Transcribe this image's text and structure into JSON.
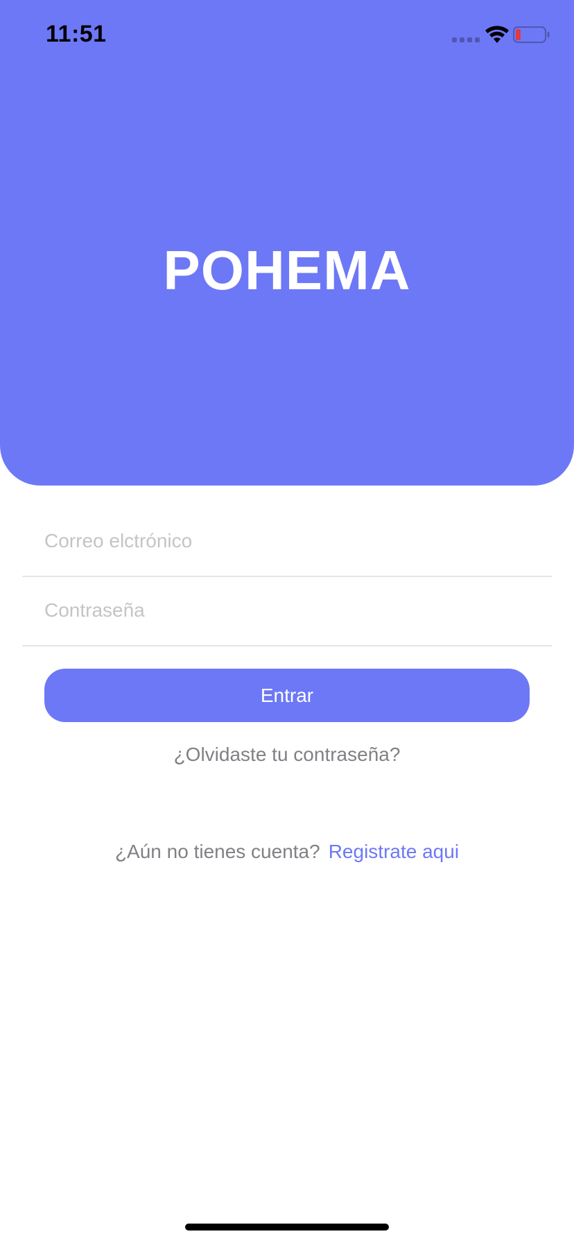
{
  "status_bar": {
    "time": "11:51"
  },
  "hero": {
    "title": "POHEMA",
    "background_color": "#6D78F6"
  },
  "form": {
    "email_placeholder": "Correo elctrónico",
    "email_value": "",
    "password_placeholder": "Contraseña",
    "password_value": "",
    "submit_label": "Entrar",
    "forgot_label": "¿Olvidaste tu contraseña?"
  },
  "signup": {
    "prompt": "¿Aún no tienes cuenta?",
    "link_label": "Registrate aqui"
  },
  "icons": {
    "signal": "signal-icon",
    "wifi": "wifi-icon",
    "battery": "battery-icon"
  },
  "colors": {
    "accent": "#6D78F6",
    "battery_low": "#E0393E",
    "muted_text": "#808085",
    "placeholder": "#C4C4C8"
  }
}
